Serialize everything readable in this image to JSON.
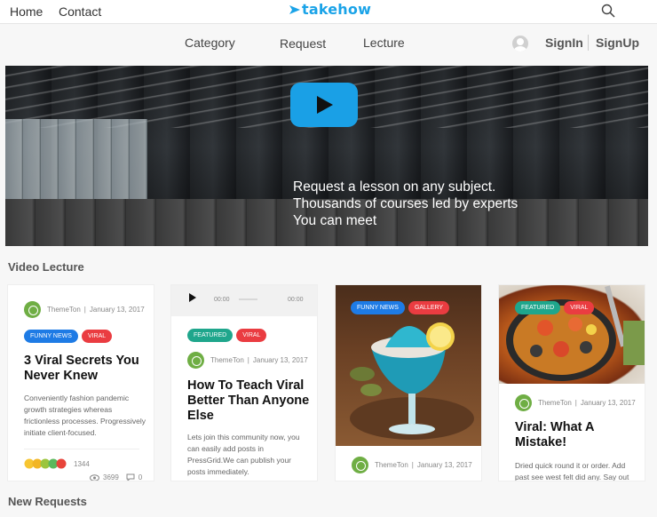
{
  "topnav": {
    "home": "Home",
    "contact": "Contact"
  },
  "logo": {
    "text": "takehow"
  },
  "subnav": {
    "category": "Category",
    "request": "Request",
    "lecture": "Lecture",
    "signin": "SignIn",
    "signup": "SignUp"
  },
  "hero": {
    "lines": [
      "Request a lesson on any subject.",
      "Thousands of courses led by experts",
      "You can meet"
    ]
  },
  "sections": {
    "video_lecture": "Video Lecture",
    "new_requests": "New Requests"
  },
  "audio": {
    "current": "00:00",
    "duration": "00:00"
  },
  "cards": [
    {
      "author": "ThemeTon",
      "date": "January 13, 2017",
      "tags": [
        "FUNNY NEWS",
        "VIRAL"
      ],
      "title": "3 Viral Secrets You Never Knew",
      "excerpt": "Conveniently fashion pandemic growth strategies whereas frictionless processes. Progressively initiate client-focused.",
      "reactions": "1344",
      "views": "3699",
      "comments": "0"
    },
    {
      "author": "ThemeTon",
      "date": "January 13, 2017",
      "tags": [
        "FEATURED",
        "VIRAL"
      ],
      "title": "How To Teach Viral Better Than Anyone Else",
      "excerpt": "Lets join this community now, you can easily add posts in PressGrid.We can publish your posts immediately."
    },
    {
      "author": "ThemeTon",
      "date": "January 13, 2017",
      "tags": [
        "FUNNY NEWS",
        "GALLERY"
      ]
    },
    {
      "author": "ThemeTon",
      "date": "January 13, 2017",
      "tags": [
        "FEATURED",
        "VIRAL"
      ],
      "title": "Viral: What A Mistake!",
      "excerpt": "Dried quick round it or order. Add past see west felt did any. Say out"
    }
  ],
  "colors": {
    "brand": "#1aa3e8",
    "tag_blue": "#1e7be5",
    "tag_red": "#ea3c41",
    "tag_teal": "#1fa68c",
    "author_avatar": "#6fae44"
  }
}
